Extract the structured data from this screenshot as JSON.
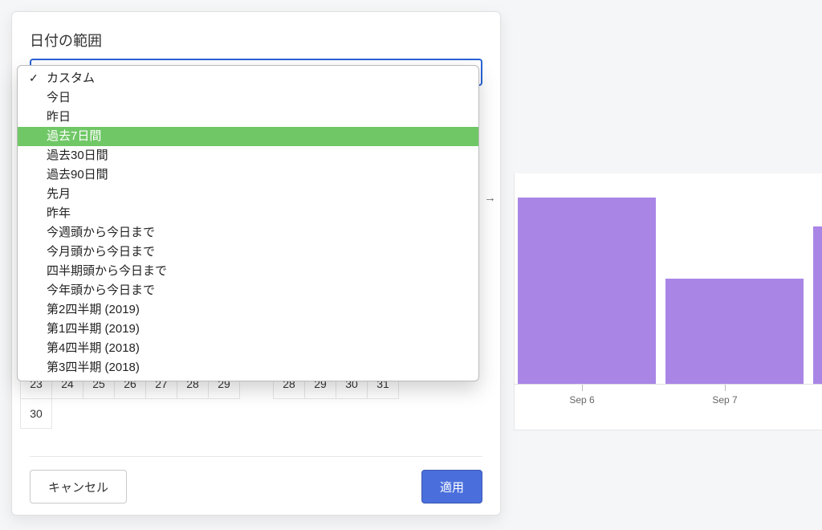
{
  "modal": {
    "title": "日付の範囲",
    "cancel": "キャンセル",
    "apply": "適用"
  },
  "range_options": [
    {
      "label": "カスタム",
      "selected": true,
      "highlight": false
    },
    {
      "label": "今日",
      "selected": false,
      "highlight": false
    },
    {
      "label": "昨日",
      "selected": false,
      "highlight": false
    },
    {
      "label": "過去7日間",
      "selected": false,
      "highlight": true
    },
    {
      "label": "過去30日間",
      "selected": false,
      "highlight": false
    },
    {
      "label": "過去90日間",
      "selected": false,
      "highlight": false
    },
    {
      "label": "先月",
      "selected": false,
      "highlight": false
    },
    {
      "label": "昨年",
      "selected": false,
      "highlight": false
    },
    {
      "label": "今週頭から今日まで",
      "selected": false,
      "highlight": false
    },
    {
      "label": "今月頭から今日まで",
      "selected": false,
      "highlight": false
    },
    {
      "label": "四半期頭から今日まで",
      "selected": false,
      "highlight": false
    },
    {
      "label": "今年頭から今日まで",
      "selected": false,
      "highlight": false
    },
    {
      "label": "第2四半期 (2019)",
      "selected": false,
      "highlight": false
    },
    {
      "label": "第1四半期 (2019)",
      "selected": false,
      "highlight": false
    },
    {
      "label": "第4四半期 (2018)",
      "selected": false,
      "highlight": false
    },
    {
      "label": "第3四半期 (2018)",
      "selected": false,
      "highlight": false
    }
  ],
  "calendar_left": {
    "rows": [
      [
        "23",
        "24",
        "25",
        "26",
        "27",
        "28",
        "29"
      ],
      [
        "30",
        "",
        "",
        "",
        "",
        "",
        ""
      ]
    ]
  },
  "calendar_right": {
    "rows": [
      [
        "28",
        "29",
        "30",
        "31",
        "",
        "",
        ""
      ]
    ]
  },
  "chart_data": {
    "type": "bar",
    "categories": [
      "Sep 6",
      "Sep 7",
      ""
    ],
    "values": [
      230,
      130,
      195
    ],
    "ylim": [
      0,
      260
    ],
    "color": "#a986e6"
  }
}
